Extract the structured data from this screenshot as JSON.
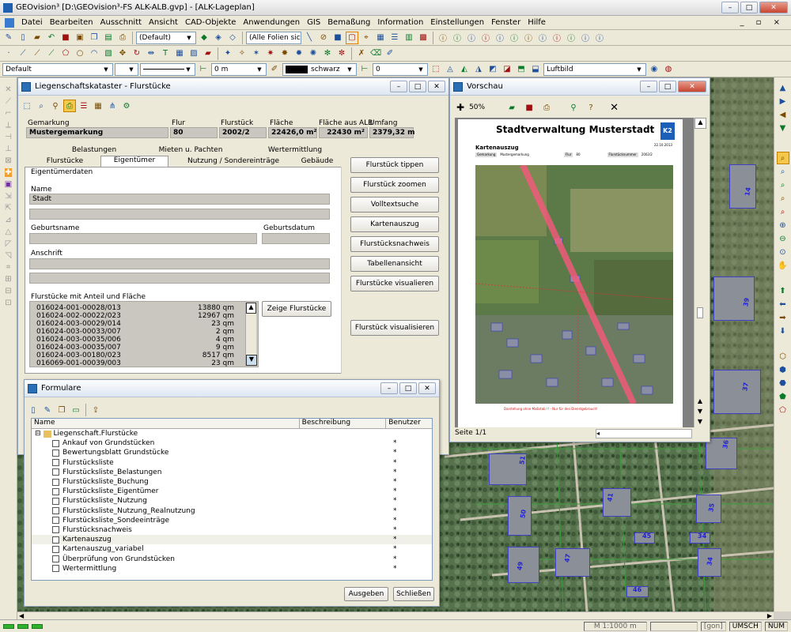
{
  "app": {
    "title": "GEOvision³  [D:\\GEOvision³-FS ALK-ALB.gvp] - [ALK-Lageplan]"
  },
  "menu": [
    "Datei",
    "Bearbeiten",
    "Ausschnitt",
    "Ansicht",
    "CAD-Objekte",
    "Anwendungen",
    "GIS",
    "Bemaßung",
    "Information",
    "Einstellungen",
    "Fenster",
    "Hilfe"
  ],
  "toolbar": {
    "style_combo": "(Default)",
    "folien_combo": "(Alle Folien sich"
  },
  "propbar": {
    "layer": "Default",
    "width": "0 m",
    "color": "schwarz",
    "number": "0",
    "layer2": "Luftbild"
  },
  "kataster": {
    "title": "Liegenschaftskataster - Flurstücke",
    "headers": [
      "Gemarkung",
      "Flur",
      "Flurstück",
      "Fläche",
      "Fläche aus ALB",
      "Umfang"
    ],
    "values": [
      "Mustergemarkung",
      "80",
      "2002/2",
      "22426,0 m²",
      "22430 m²",
      "2379,32 m"
    ],
    "tabs_row1": [
      "Belastungen",
      "Mieten u. Pachten",
      "Wertermittlung"
    ],
    "tabs_row2": [
      "Flurstücke",
      "Eigentümer",
      "Nutzung / Sondereinträge",
      "Gebäude"
    ],
    "group": "Eigentümerdaten",
    "name_label": "Name",
    "name_value": "Stadt",
    "geburtsname_label": "Geburtsname",
    "geburtsdatum_label": "Geburtsdatum",
    "anschrift_label": "Anschrift",
    "flst_label": "Flurstücke mit Anteil und Fläche",
    "flst_rows": [
      [
        "016024-001-00028/013",
        "13880 qm"
      ],
      [
        "016024-002-00022/023",
        "12967 qm"
      ],
      [
        "016024-003-00029/014",
        "23 qm"
      ],
      [
        "016024-003-00033/007",
        "2 qm"
      ],
      [
        "016024-003-00035/006",
        "4 qm"
      ],
      [
        "016024-003-00035/007",
        "9 qm"
      ],
      [
        "016024-003-00180/023",
        "8517 qm"
      ],
      [
        "016069-001-00039/003",
        "23 qm"
      ]
    ],
    "show_button": "Zeige Flurstücke",
    "side_buttons": [
      "Flurstück tippen",
      "Flurstück zoomen",
      "Volltextsuche",
      "Kartenauszug",
      "Flurstücksnachweis",
      "Tabellenansicht",
      "Flurstücke visualieren"
    ],
    "vis_button": "Flurstück visualisieren"
  },
  "formulare": {
    "title": "Formulare",
    "col_name": "Name",
    "col_desc": "Beschreibung",
    "col_user": "Benutzer",
    "root": "Liegenschaft.Flurstücke",
    "items": [
      "Ankauf von Grundstücken",
      "Bewertungsblatt Grundstücke",
      "Flurstücksliste",
      "Flurstücksliste_Belastungen",
      "Flurstücksliste_Buchung",
      "Flurstücksliste_Eigentümer",
      "Flurstücksliste_Nutzung",
      "Flurstücksliste_Nutzung_Realnutzung",
      "Flurstücksliste_Sondeeinträge",
      "Flurstücksnachweis",
      "Kartenauszug",
      "Kartenauszug_variabel",
      "Überprüfung von Grundstücken",
      "Wertermittlung"
    ],
    "user_mark": "*",
    "btn_print": "Ausgeben",
    "btn_close": "Schließen"
  },
  "vorschau": {
    "title": "Vorschau",
    "zoom": "50%",
    "doc_title": "Stadtverwaltung Musterstadt",
    "logo": "K2",
    "date": "22.10.2013",
    "section": "Kartenauszug",
    "fields": [
      "Gemarkung",
      "Mustergemarkung",
      "Flur",
      "80",
      "Flurstücknummer",
      "2002/2"
    ],
    "footer": "Darstellung ohne Maßstab !! - Nur für den Dienstgebrauch!",
    "page": "Seite 1/1"
  },
  "map": {
    "house_numbers": [
      "14",
      "39",
      "37",
      "36",
      "51",
      "50",
      "41",
      "35",
      "45",
      "34",
      "49",
      "47",
      "34",
      "46"
    ]
  },
  "status": {
    "scale": "M 1:1000  m",
    "unit": "[gon]",
    "umsch": "UMSCH",
    "num": "NUM"
  }
}
